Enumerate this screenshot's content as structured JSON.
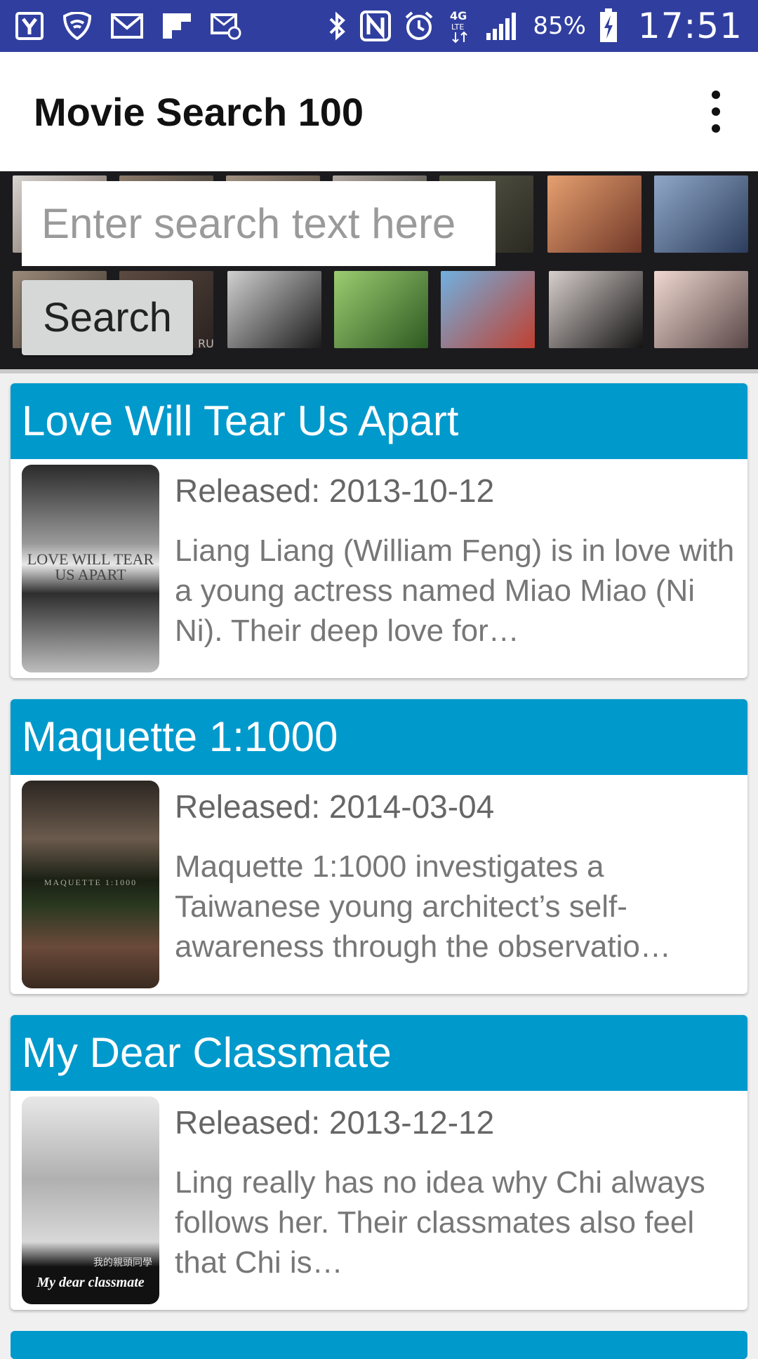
{
  "status_bar": {
    "battery": "85%",
    "time": "17:51",
    "network": "4G LTE",
    "left_icons": [
      "yahoo-icon",
      "wifi-shield-icon",
      "mail-icon",
      "flipboard-icon",
      "email-at-icon"
    ],
    "right_icons": [
      "bluetooth-icon",
      "nfc-icon",
      "alarm-icon",
      "lte-icon",
      "signal-icon",
      "battery-charging-icon"
    ]
  },
  "app_bar": {
    "title": "Movie Search 100"
  },
  "search": {
    "placeholder": "Enter search text here",
    "value": "",
    "button_label": "Search"
  },
  "banner": {
    "watermark": "RU"
  },
  "movies": [
    {
      "title": "Love Will Tear Us Apart",
      "released": "Released: 2013-10-12",
      "description": "Liang Liang (William Feng) is in love with a young actress named Miao Miao (Ni Ni). Their deep love for…",
      "poster_text": "LOVE WILL TEAR US APART"
    },
    {
      "title": "Maquette 1:1000",
      "released": "Released: 2014-03-04",
      "description": "Maquette 1:1000 investigates a Taiwanese young architect’s self-awareness through the observatio…",
      "poster_text": "MAQUETTE 1:1000"
    },
    {
      "title": "My Dear Classmate",
      "released": "Released: 2013-12-12",
      "description": "Ling really has no idea why Chi always follows her. Their classmates also feel that Chi is…",
      "poster_text": "My dear classmate",
      "poster_text_zh": "我的親頭同學"
    }
  ],
  "colors": {
    "status_bar": "#303f9f",
    "card_header": "#0099cc",
    "banner_bg": "#1b1b1e"
  }
}
